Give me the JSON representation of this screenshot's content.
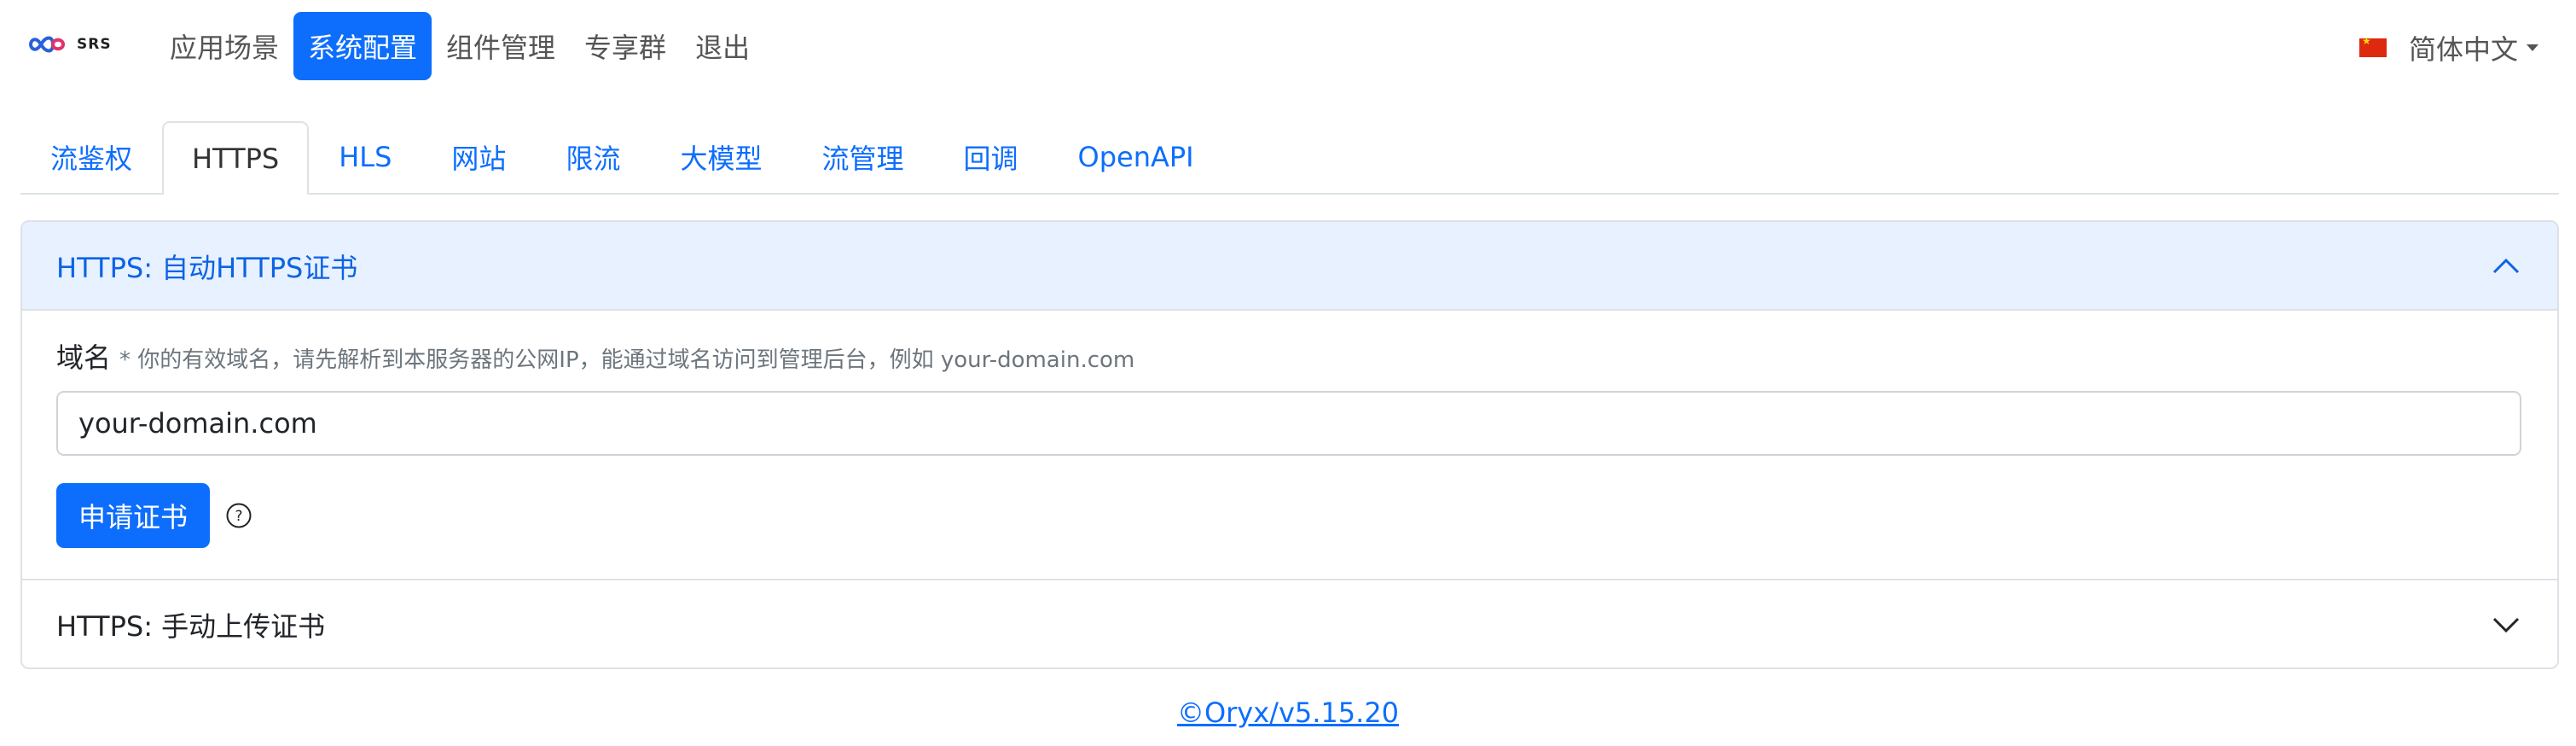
{
  "navbar": {
    "logo_text": "SRS",
    "items": [
      {
        "label": "应用场景"
      },
      {
        "label": "系统配置"
      },
      {
        "label": "组件管理"
      },
      {
        "label": "专享群"
      },
      {
        "label": "退出"
      }
    ],
    "active_index": 1,
    "language": "简体中文",
    "language_flag": "china-flag-icon"
  },
  "tabs": [
    {
      "label": "流鉴权"
    },
    {
      "label": "HTTPS"
    },
    {
      "label": "HLS"
    },
    {
      "label": "网站"
    },
    {
      "label": "限流"
    },
    {
      "label": "大模型"
    },
    {
      "label": "流管理"
    },
    {
      "label": "回调"
    },
    {
      "label": "OpenAPI"
    }
  ],
  "active_tab_index": 1,
  "https": {
    "auto": {
      "title": "HTTPS: 自动HTTPS证书",
      "expanded": true,
      "domain_label": "域名",
      "domain_hint": "* 你的有效域名，请先解析到本服务器的公网IP，能通过域名访问到管理后台，例如 your-domain.com",
      "domain_value": "your-domain.com",
      "apply_button": "申请证书",
      "help_icon": "question-circle-icon"
    },
    "manual": {
      "title": "HTTPS: 手动上传证书",
      "expanded": false
    }
  },
  "footer": {
    "version_link": "©Oryx/v5.15.20"
  },
  "colors": {
    "primary": "#0d6efd",
    "accordion_active_bg": "#e7f1ff",
    "accordion_active_text": "#0c63e4"
  }
}
